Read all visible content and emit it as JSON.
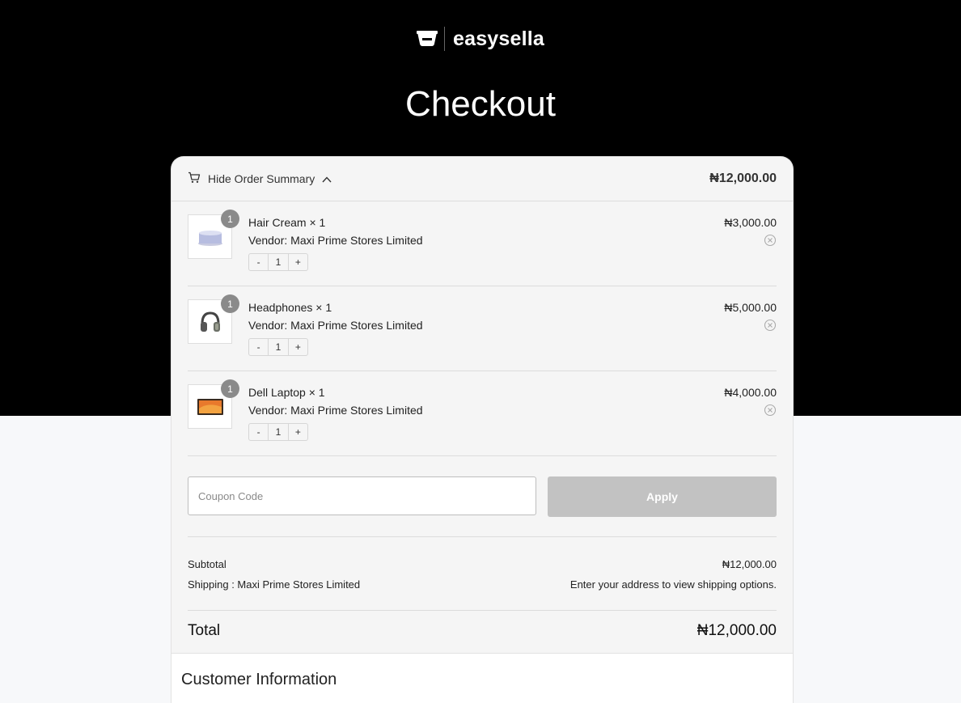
{
  "brand": {
    "name": "easysella"
  },
  "page": {
    "title": "Checkout"
  },
  "summary": {
    "toggle_label": "Hide Order Summary",
    "header_total": "₦12,000.00",
    "items": [
      {
        "name": "Hair Cream × 1",
        "vendor": "Vendor: Maxi Prime Stores Limited",
        "price": "₦3,000.00",
        "qty_badge": "1",
        "qty": "1",
        "thumb": "hair-cream-image"
      },
      {
        "name": "Headphones × 1",
        "vendor": "Vendor: Maxi Prime Stores Limited",
        "price": "₦5,000.00",
        "qty_badge": "1",
        "qty": "1",
        "thumb": "headphones-image"
      },
      {
        "name": "Dell Laptop × 1",
        "vendor": "Vendor: Maxi Prime Stores Limited",
        "price": "₦4,000.00",
        "qty_badge": "1",
        "qty": "1",
        "thumb": "laptop-image"
      }
    ],
    "stepper": {
      "minus": "-",
      "plus": "+"
    },
    "coupon": {
      "placeholder": "Coupon Code",
      "apply_label": "Apply"
    },
    "subtotal_label": "Subtotal",
    "subtotal_value": "₦12,000.00",
    "shipping_label": "Shipping : Maxi Prime Stores Limited",
    "shipping_value": "Enter your address to view shipping options.",
    "total_label": "Total",
    "total_value": "₦12,000.00"
  },
  "customer": {
    "heading": "Customer Information"
  },
  "colors": {
    "hero": "#000000",
    "card": "#f5f5f5",
    "apply_disabled": "#c2c2c2",
    "badge": "#8a8a8a"
  }
}
